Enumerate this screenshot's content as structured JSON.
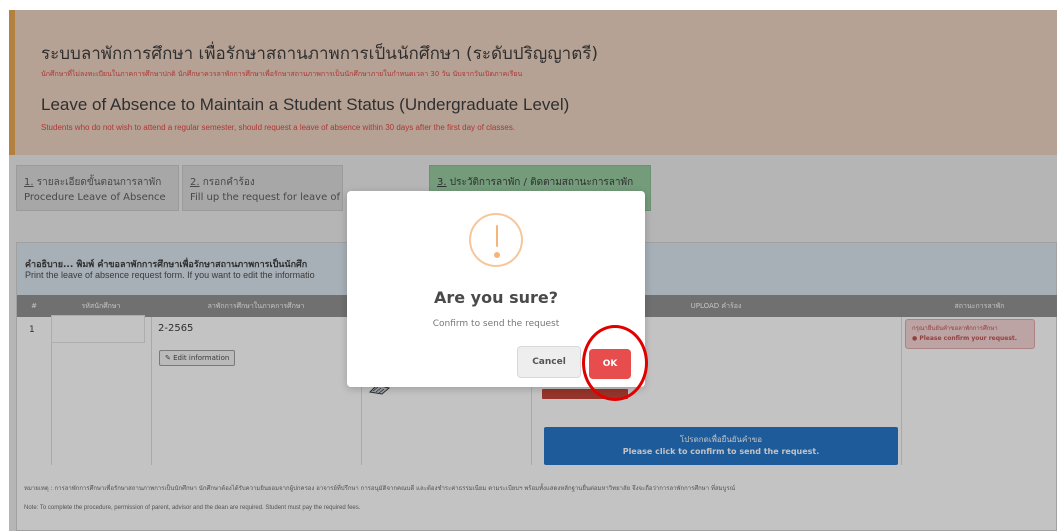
{
  "header": {
    "th_title": "ระบบลาพักการศึกษา เพื่อรักษาสถานภาพการเป็นนักศึกษา (ระดับปริญญาตรี)",
    "th_subtitle": "นักศึกษาที่ไม่ลงทะเบียนในภาคการศึกษาปกติ นักศึกษาควรลาพักการศึกษาเพื่อรักษาสถานภาพการเป็นนักศึกษาภายในกำหนดเวลา 30 วัน นับจากวันเปิดภาคเรียน",
    "en_title": "Leave of Absence to Maintain a Student Status (Undergraduate Level)",
    "en_subtitle": "Students who do not wish to attend a regular semester, should request a leave of absence within 30 days after the first day of classes."
  },
  "tabs": [
    {
      "num": "1.",
      "th_label": "รายละเอียดขั้นตอนการลาพัก",
      "en_label": "Procedure Leave of Absence"
    },
    {
      "num": "2.",
      "th_label": "กรอกคำร้อง",
      "en_label": "Fill up the request for leave of"
    },
    {
      "num": "3.",
      "th_label": "ประวัติการลาพัก / ติดตามสถานะการลาพัก",
      "en_label": ""
    }
  ],
  "panel": {
    "th_heading": "คำอธิบาย... พิมพ์ คำขอลาพักการศึกษาเพื่อรักษาสถานภาพการเป็นนักศึก",
    "en_heading": "Print the leave of absence request form. If you want to edit the informatio",
    "columns": [
      "#",
      "รหัสนักศึกษา",
      "ลาพักการศึกษาในภาคการศึกษา",
      "",
      "UPLOAD คำร้อง",
      "สถานะการลาพัก"
    ],
    "row": {
      "num": "1",
      "semester": "2-2565",
      "edit_label": "Edit information",
      "confirm_th": "โปรดกดเพื่อยืนยันคำขอ",
      "confirm_en": "Please click to confirm to send the request.",
      "status_th": "กรุณายืนยันคำขอลาพักการศึกษา",
      "status_en": "Please confirm your request."
    },
    "note_th": "หมายเหตุ : การลาพักการศึกษาเพื่อรักษาสถานภาพการเป็นนักศึกษา นักศึกษาต้องได้รับความยินยอมจากผู้ปกครอง อาจารย์ที่ปรึกษา การอนุมัติจากคณบดี และต้องชำระค่าธรรมเนียม ตามระเบียบฯ พร้อมทั้งแสดงหลักฐานยื่นต่อมหาวิทยาลัย จึงจะถือว่าการลาพักการศึกษา ที่สมบูรณ์",
    "note_en": "Note: To complete the procedure, permission of parent, advisor and the dean are required. Student must pay the required fees."
  },
  "modal": {
    "title": "Are you sure?",
    "text": "Confirm to send the request",
    "cancel_label": "Cancel",
    "ok_label": "OK"
  },
  "colors": {
    "accent_orange": "#e8a44a",
    "ok_red": "#e84d4d",
    "confirm_blue": "#1a6fc8",
    "active_tab_green": "#92c99b",
    "highlight_red": "#e00000"
  },
  "icons": [
    "exclamation-warning-icon",
    "edit-pencil-icon",
    "info-circle-icon",
    "document-icon"
  ]
}
